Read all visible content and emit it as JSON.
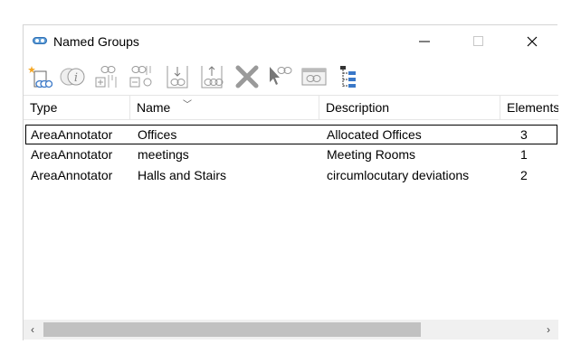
{
  "window": {
    "title": "Named Groups"
  },
  "toolbar": {
    "buttons": [
      {
        "icon": "create-group-icon"
      },
      {
        "icon": "group-info-icon"
      },
      {
        "icon": "add-to-group-icon"
      },
      {
        "icon": "remove-from-group-icon"
      },
      {
        "icon": "drop-into-group-icon"
      },
      {
        "icon": "lift-from-group-icon"
      },
      {
        "icon": "delete-icon"
      },
      {
        "icon": "select-elements-icon"
      },
      {
        "icon": "group-view-icon"
      },
      {
        "icon": "tree-view-icon"
      }
    ]
  },
  "table": {
    "columns": [
      "Type",
      "Name",
      "Description",
      "Elements"
    ],
    "rows": [
      {
        "type": "AreaAnnotator",
        "name": "Offices",
        "description": "Allocated Offices",
        "elements": "3"
      },
      {
        "type": "AreaAnnotator",
        "name": "meetings",
        "description": "Meeting Rooms",
        "elements": "1"
      },
      {
        "type": "AreaAnnotator",
        "name": "Halls and Stairs",
        "description": "circumlocutary deviations",
        "elements": "2"
      }
    ]
  },
  "scrollbar": {
    "left_glyph": "‹",
    "right_glyph": "›"
  },
  "colors": {
    "icon_gray": "#9a9a9a",
    "icon_blue": "#3a78c8",
    "selection_border": "#000000"
  }
}
